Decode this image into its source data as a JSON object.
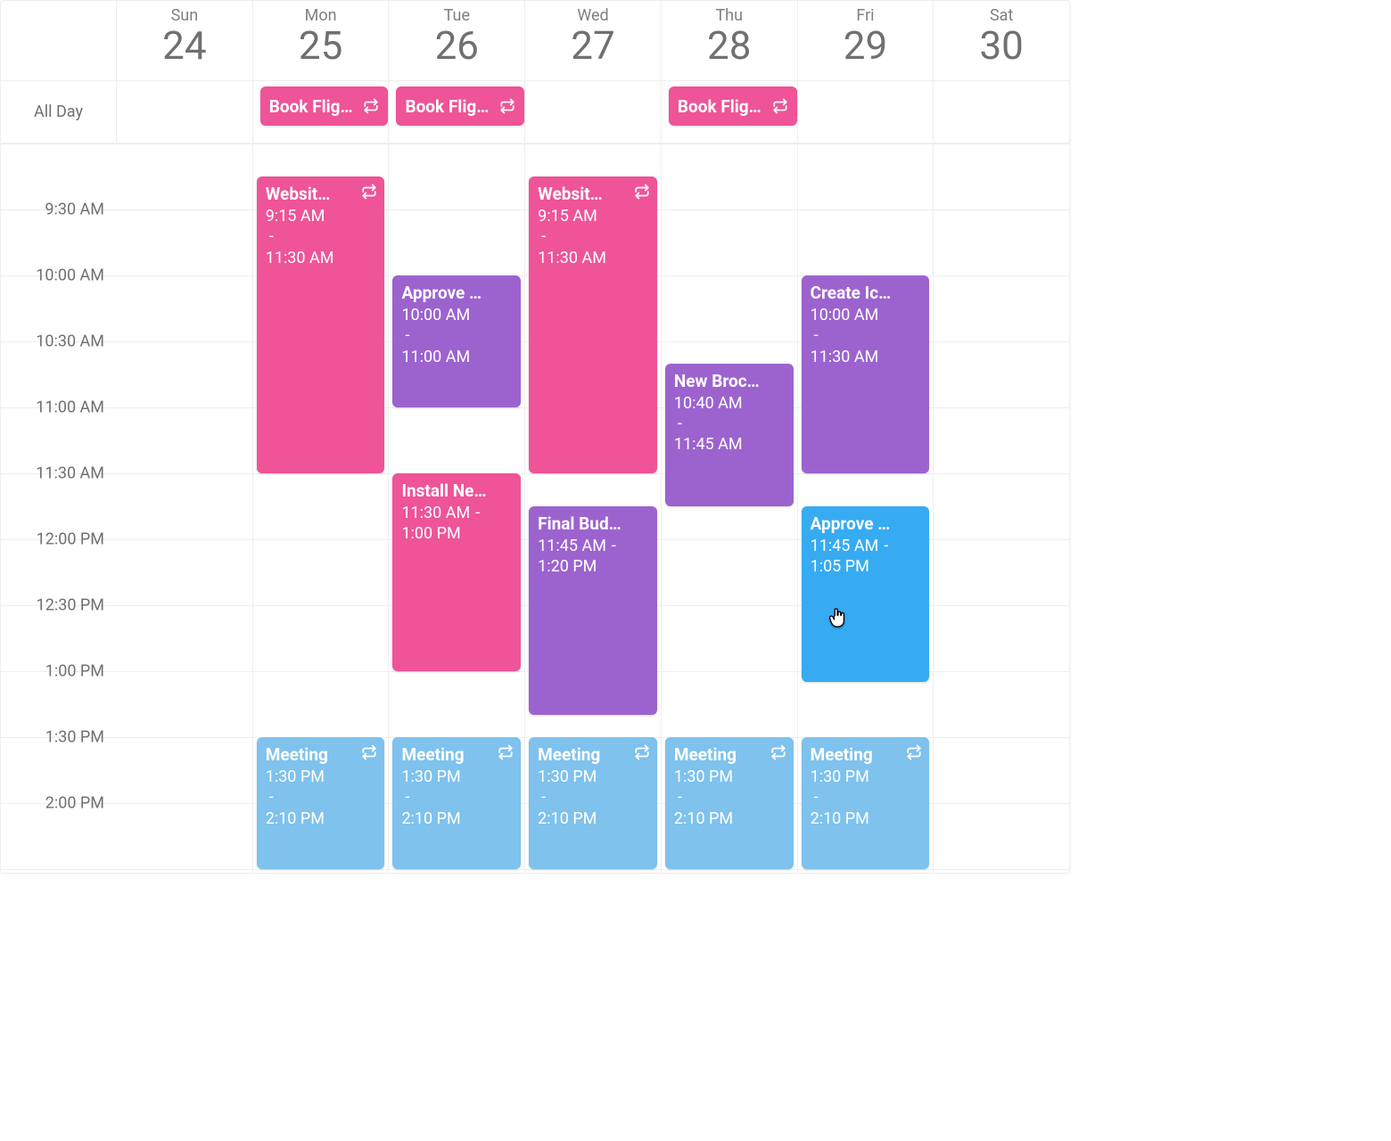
{
  "layout": {
    "slotMinutes": 30,
    "slotHeightPx": 74,
    "startMinutes": 540,
    "visibleSlots": 11
  },
  "header": {
    "days": [
      {
        "abbr": "Sun",
        "num": "24"
      },
      {
        "abbr": "Mon",
        "num": "25"
      },
      {
        "abbr": "Tue",
        "num": "26"
      },
      {
        "abbr": "Wed",
        "num": "27"
      },
      {
        "abbr": "Thu",
        "num": "28"
      },
      {
        "abbr": "Fri",
        "num": "29"
      },
      {
        "abbr": "Sat",
        "num": "30"
      }
    ],
    "alldayLabel": "All Day"
  },
  "timeLabels": [
    "9:30 AM",
    "10:00 AM",
    "10:30 AM",
    "11:00 AM",
    "11:30 AM",
    "12:00 PM",
    "12:30 PM",
    "1:00 PM",
    "1:30 PM",
    "2:00 PM"
  ],
  "colors": {
    "pink": "#ee5497",
    "purple": "#9c63cf",
    "blue": "#7ec2ed",
    "blue2": "#37abf2"
  },
  "alldayEvents": [
    {
      "day": 1,
      "title": "Book Flig…",
      "color": "pink",
      "repeat": true
    },
    {
      "day": 2,
      "title": "Book Flig…",
      "color": "pink",
      "repeat": true
    },
    {
      "day": 4,
      "title": "Book Flig…",
      "color": "pink",
      "repeat": true
    }
  ],
  "events": [
    {
      "day": 1,
      "title": "Websit…",
      "start": "9:15 AM",
      "end": "11:30 AM",
      "color": "pink",
      "repeat": true,
      "startMin": 555,
      "endMin": 690,
      "inline": false
    },
    {
      "day": 2,
      "title": "Approve …",
      "start": "10:00 AM",
      "end": "11:00 AM",
      "color": "purple",
      "repeat": false,
      "startMin": 600,
      "endMin": 660,
      "inline": false
    },
    {
      "day": 2,
      "title": "Install Ne…",
      "start": "11:30 AM",
      "end": "1:00 PM",
      "color": "pink",
      "repeat": false,
      "startMin": 690,
      "endMin": 780,
      "inline": true
    },
    {
      "day": 3,
      "title": "Websit…",
      "start": "9:15 AM",
      "end": "11:30 AM",
      "color": "pink",
      "repeat": true,
      "startMin": 555,
      "endMin": 690,
      "inline": false
    },
    {
      "day": 3,
      "title": "Final Bud…",
      "start": "11:45 AM",
      "end": "1:20 PM",
      "color": "purple",
      "repeat": false,
      "startMin": 705,
      "endMin": 800,
      "inline": true
    },
    {
      "day": 4,
      "title": "New Broc…",
      "start": "10:40 AM",
      "end": "11:45 AM",
      "color": "purple",
      "repeat": false,
      "startMin": 640,
      "endMin": 705,
      "inline": false
    },
    {
      "day": 5,
      "title": "Create Ic…",
      "start": "10:00 AM",
      "end": "11:30 AM",
      "color": "purple",
      "repeat": false,
      "startMin": 600,
      "endMin": 690,
      "inline": false
    },
    {
      "day": 5,
      "title": "Approve …",
      "start": "11:45 AM",
      "end": "1:05 PM",
      "color": "blue2",
      "repeat": false,
      "startMin": 705,
      "endMin": 785,
      "inline": true
    },
    {
      "day": 1,
      "title": "Meeting",
      "start": "1:30 PM",
      "end": "2:10 PM",
      "color": "blue",
      "repeat": true,
      "startMin": 810,
      "endMin": 870,
      "inline": false
    },
    {
      "day": 2,
      "title": "Meeting",
      "start": "1:30 PM",
      "end": "2:10 PM",
      "color": "blue",
      "repeat": true,
      "startMin": 810,
      "endMin": 870,
      "inline": false
    },
    {
      "day": 3,
      "title": "Meeting",
      "start": "1:30 PM",
      "end": "2:10 PM",
      "color": "blue",
      "repeat": true,
      "startMin": 810,
      "endMin": 870,
      "inline": false
    },
    {
      "day": 4,
      "title": "Meeting",
      "start": "1:30 PM",
      "end": "2:10 PM",
      "color": "blue",
      "repeat": true,
      "startMin": 810,
      "endMin": 870,
      "inline": false
    },
    {
      "day": 5,
      "title": "Meeting",
      "start": "1:30 PM",
      "end": "2:10 PM",
      "color": "blue",
      "repeat": true,
      "startMin": 810,
      "endMin": 870,
      "inline": false
    }
  ],
  "cursor": {
    "day": 5,
    "atMin": 752
  }
}
